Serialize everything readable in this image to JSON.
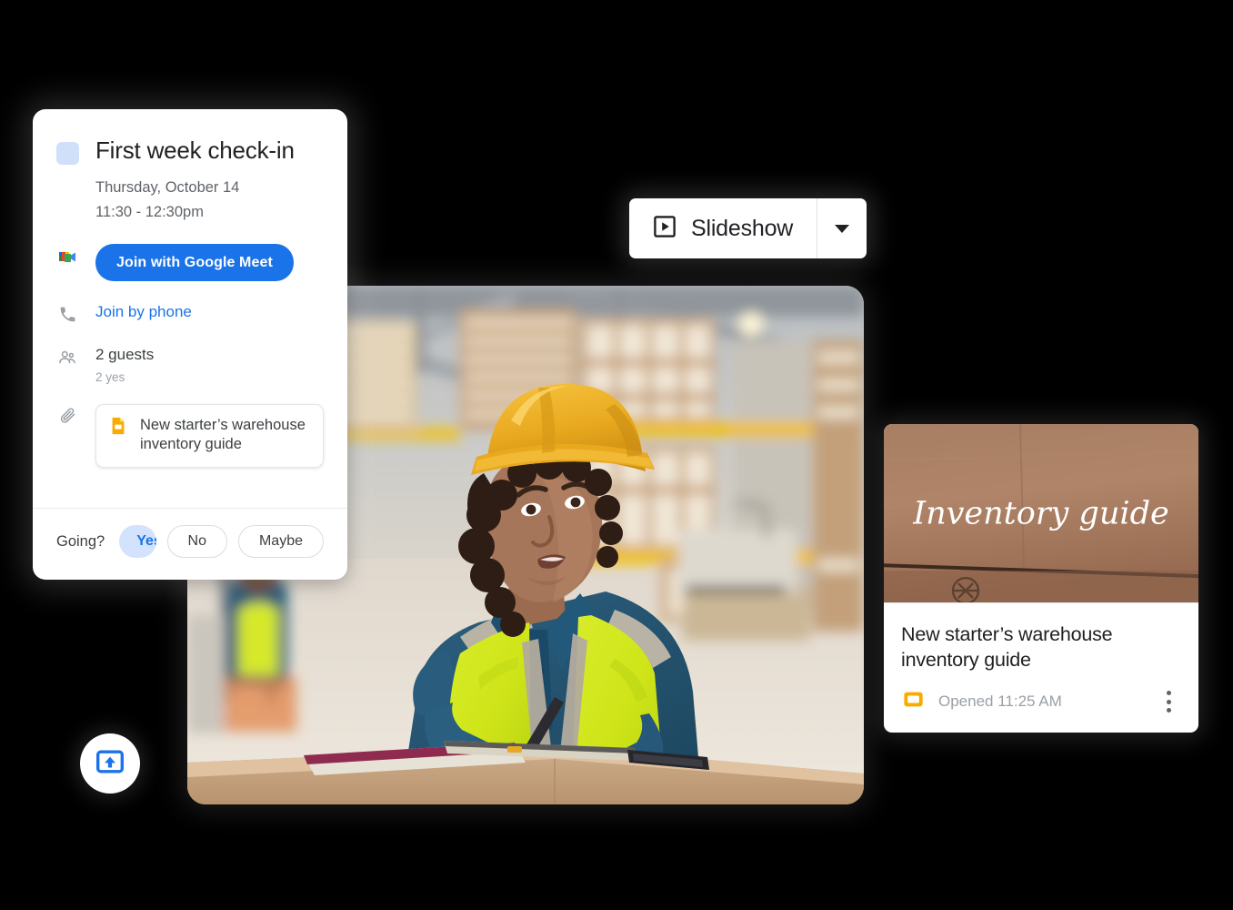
{
  "background_color": "#000000",
  "event_card": {
    "color_swatch": "#cfe0f8",
    "title": "First week check-in",
    "date": "Thursday, October 14",
    "time": "11:30 - 12:30pm",
    "meet_button_label": "Join with Google Meet",
    "meet_button_color": "#1a73e8",
    "meet_icon_name": "google-meet-icon",
    "phone_icon_name": "phone-icon",
    "phone_link_label": "Join by phone",
    "phone_link_color": "#1a73e8",
    "guests_icon_name": "people-icon",
    "guests_count_label": "2 guests",
    "guests_response_label": "2 yes",
    "attachment_icon_name": "paperclip-icon",
    "attachment": {
      "file_icon_name": "google-slides-icon",
      "file_icon_color": "#f9ab00",
      "title": "New starter’s warehouse inventory guide"
    },
    "rsvp": {
      "question": "Going?",
      "yes_label": "Yes",
      "yes_selected_bg": "#d3e3fd",
      "yes_text_color": "#1a73e8",
      "yes_dropdown_icon_name": "chevron-down-icon",
      "no_label": "No",
      "maybe_label": "Maybe"
    }
  },
  "slideshow_button": {
    "icon_name": "play-in-box-icon",
    "label": "Slideshow",
    "dropdown_icon_name": "chevron-down-icon"
  },
  "photo_card": {
    "alt_name": "warehouse-worker-photo",
    "description": "Woman in yellow hard hat and hi-vis vest writing on a clipboard atop a cardboard box in a warehouse"
  },
  "doc_card": {
    "thumbnail": {
      "name": "inventory-guide-thumbnail",
      "overlay_text": "Inventory guide",
      "overlay_text_color": "#ffffff",
      "background_description": "cardboard box surface"
    },
    "title": "New starter’s warehouse inventory guide",
    "file_icon_name": "google-slides-icon",
    "file_icon_color": "#f9ab00",
    "opened_label": "Opened 11:25 AM",
    "menu_icon_name": "more-vertical-icon"
  },
  "upload_fab": {
    "icon_name": "upload-icon",
    "icon_color": "#1a73e8"
  }
}
